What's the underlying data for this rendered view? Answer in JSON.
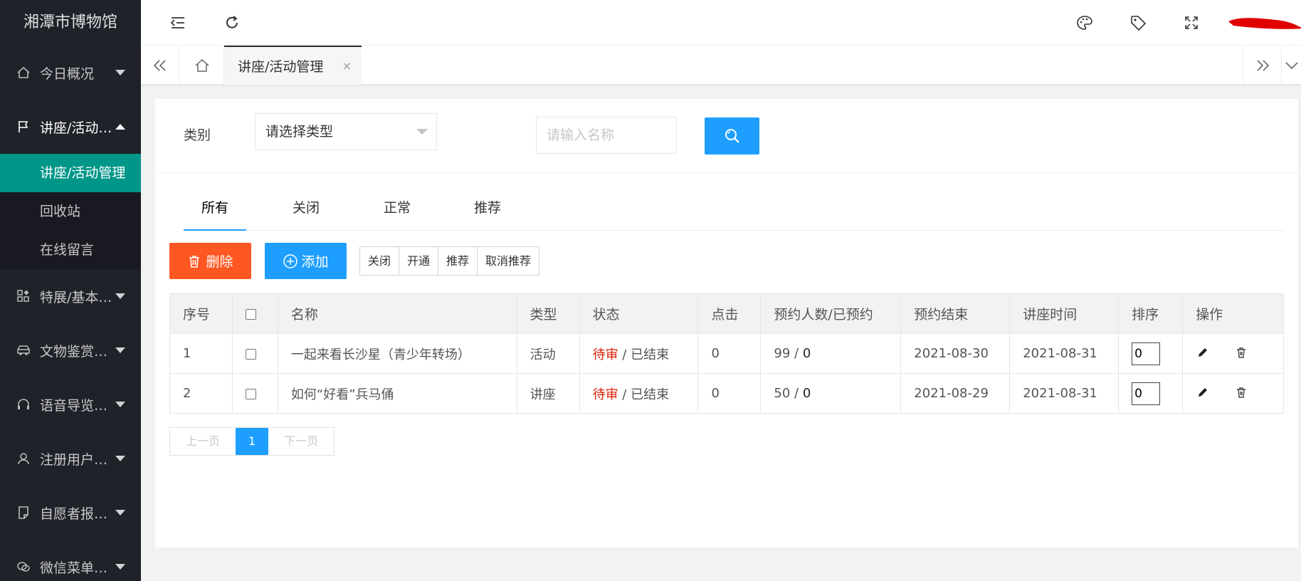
{
  "app": {
    "title": "湘潭市博物馆"
  },
  "sidebar": {
    "items": [
      {
        "label": "今日概况"
      },
      {
        "label": "讲座/活动管理",
        "sub": [
          "讲座/活动管理",
          "回收站",
          "在线留言"
        ]
      },
      {
        "label": "特展/基本陈列"
      },
      {
        "label": "文物鉴赏管理"
      },
      {
        "label": "语音导览管理"
      },
      {
        "label": "注册用户管理"
      },
      {
        "label": "自愿者报名管理"
      },
      {
        "label": "微信菜单管理"
      }
    ]
  },
  "tabsbar": {
    "active_tab": "讲座/活动管理",
    "close": "×"
  },
  "filter": {
    "category_label": "类别",
    "category_value": "请选择类型",
    "search_placeholder": "请输入名称"
  },
  "tabs": [
    "所有",
    "关闭",
    "正常",
    "推荐"
  ],
  "actions": {
    "delete": "删除",
    "add": "添加",
    "group": [
      "关闭",
      "开通",
      "推荐",
      "取消推荐"
    ]
  },
  "table": {
    "headers": [
      "序号",
      "名称",
      "类型",
      "状态",
      "点击",
      "预约人数/已预约",
      "预约结束",
      "讲座时间",
      "排序",
      "操作"
    ],
    "rows": [
      {
        "no": "1",
        "name": "一起来看长沙星（青少年转场）",
        "type": "活动",
        "status_a": "待审",
        "status_sep": " / ",
        "status_b": "已结束",
        "clicks": "0",
        "cap": "99",
        "cap_sep": " / ",
        "booked": "0",
        "end": "2021-08-30",
        "time": "2021-08-31",
        "sort": "0"
      },
      {
        "no": "2",
        "name": "如何“好看”兵马俑",
        "type": "讲座",
        "status_a": "待审",
        "status_sep": " / ",
        "status_b": "已结束",
        "clicks": "0",
        "cap": "50",
        "cap_sep": " / ",
        "booked": "0",
        "end": "2021-08-29",
        "time": "2021-08-31",
        "sort": "0"
      }
    ]
  },
  "pager": {
    "prev": "上一页",
    "current": "1",
    "next": "下一页"
  },
  "colors": {
    "sidebar": "#20222a",
    "active": "#009688",
    "primary": "#1e9fff",
    "danger": "#ff5722",
    "pending": "#d81e06"
  }
}
